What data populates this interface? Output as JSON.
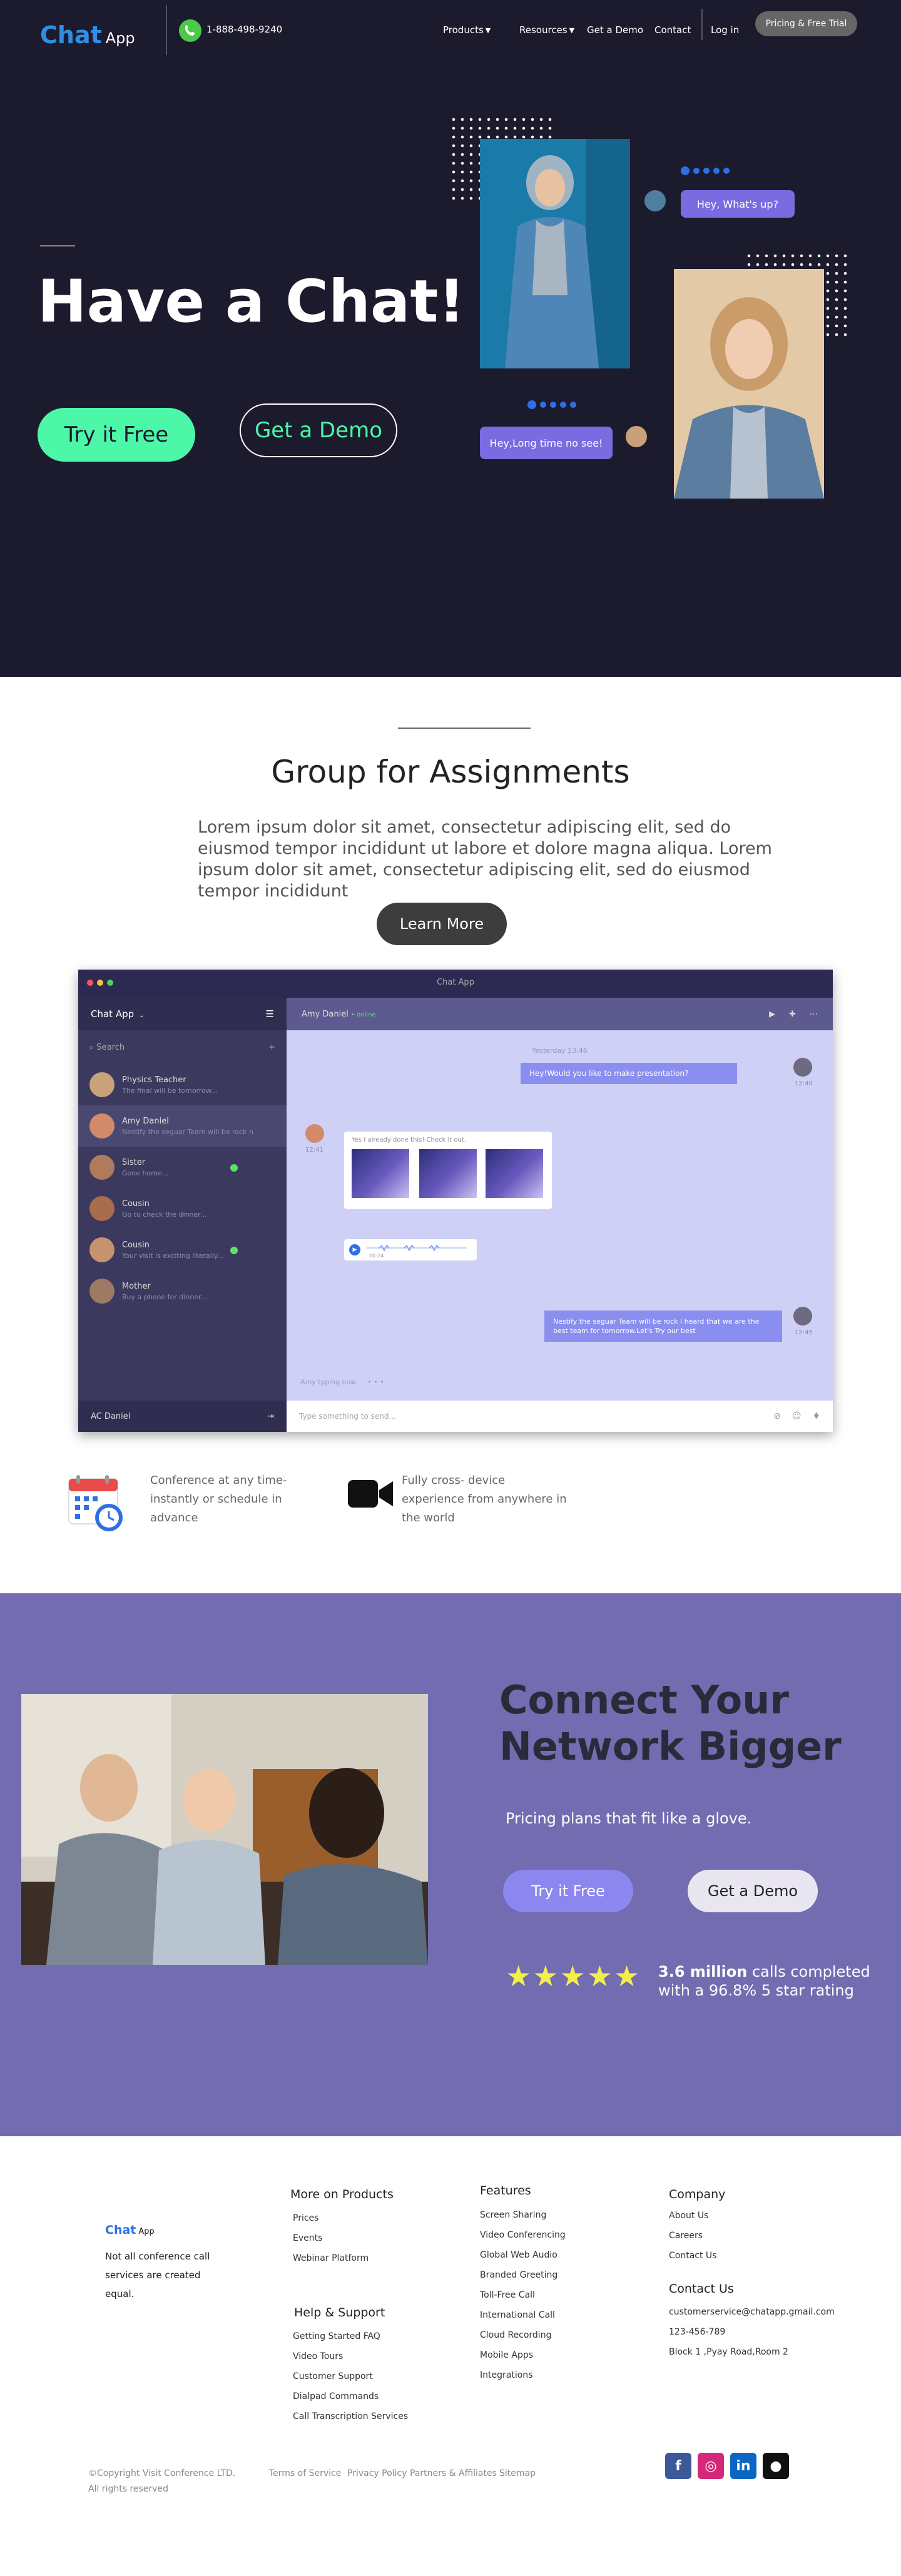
{
  "header": {
    "logo_main": "Chat",
    "logo_sub": "App",
    "phone": "1-888-498-9240",
    "nav": {
      "products": "Products",
      "resources": "Resources",
      "demo": "Get a Demo",
      "contact": "Contact",
      "login": "Log in",
      "trial": "Pricing & Free Trial"
    }
  },
  "hero": {
    "title": "Have a Chat!",
    "try_free": "Try it Free",
    "get_demo": "Get a Demo",
    "bubble_1": "Hey, What's up?",
    "bubble_2": "Hey,Long time no see!"
  },
  "assignments": {
    "title": "Group for Assignments",
    "body": "Lorem ipsum dolor sit amet, consectetur adipiscing elit, sed do eiusmod tempor incididunt ut labore et dolore magna aliqua. Lorem ipsum dolor sit amet, consectetur adipiscing elit, sed do eiusmod tempor incididunt",
    "learn_more": "Learn More"
  },
  "app_mock": {
    "window_title": "Chat App",
    "sidebar_title": "Chat App",
    "search_placeholder": "Search",
    "contacts": [
      {
        "name": "Physics Teacher",
        "preview": "The final will be tomorrow...",
        "online": false,
        "color": "#c9a27a"
      },
      {
        "name": "Amy Daniel",
        "preview": "Nestify the seguar Team will be rock n...",
        "online": false,
        "color": "#d28b6a"
      },
      {
        "name": "Sister",
        "preview": "Gone home...",
        "online": true,
        "color": "#b07a5c"
      },
      {
        "name": "Cousin",
        "preview": "Go to check the dinner...",
        "online": false,
        "color": "#a86c4e"
      },
      {
        "name": "Cousin",
        "preview": "Your visit is exciting literally...",
        "online": true,
        "color": "#c79270"
      },
      {
        "name": "Mother",
        "preview": "Buy a phone for dinner...",
        "online": false,
        "color": "#9e7a66"
      }
    ],
    "current_user": "AC Daniel",
    "chat_with": "Amy Daniel",
    "chat_status": "• online",
    "day_label": "Yesterday 13:46",
    "msg_1": "Hey!Would you like to make presentation?",
    "msg_1_time": "12:40",
    "msg_2": "Yes I already done this! Check it out.",
    "msg_2_time": "12:41",
    "audio_time": "00:24",
    "msg_3": "Nestify the seguar Team will be rock I heard that we are the best team for tomorrow.Let's Try our best",
    "msg_3_time": "12:45",
    "typing": "Amy typing now",
    "input_placeholder": "Type something to send..."
  },
  "features": [
    {
      "icon": "calendar-clock-icon",
      "text": "Conference at any time-instantly or schedule in advance"
    },
    {
      "icon": "video-camera-icon",
      "text": "Fully cross- device experience from anywhere in the world"
    }
  ],
  "connect": {
    "title_1": "Connect Your",
    "title_2": "Network Bigger",
    "subtitle": "Pricing plans that fit like a glove.",
    "try_free": "Try it Free",
    "get_demo": "Get a Demo",
    "stars": "★★★★★",
    "rating_bold": "3.6 million",
    "rating_text": " calls completed with a 96.8% 5 star rating"
  },
  "footer": {
    "logo_main": "Chat",
    "logo_sub": "App",
    "tagline": "Not all conference call services are created equal.",
    "more_on_products": "More on Products",
    "products_links": [
      "Prices",
      "Events",
      "Webinar Platform"
    ],
    "help_support": "Help & Support",
    "help_links": [
      "Getting Started FAQ",
      "Video Tours",
      "Customer Support",
      "Dialpad Commands",
      "Call Transcription Services"
    ],
    "features_title": "Features",
    "features_links": [
      "Screen Sharing",
      "Video Conferencing",
      "Global Web Audio",
      "Branded Greeting",
      "Toll-Free Call",
      "International Call",
      "Cloud Recording",
      "Mobile Apps",
      "Integrations"
    ],
    "company_title": "Company",
    "company_links": [
      "About Us",
      "Careers",
      "Contact Us"
    ],
    "contact_title": "Contact Us",
    "contact_links": [
      "customerservice@chatapp.gmail.com",
      "123-456-789",
      "Block 1 ,Pyay Road,Room 2"
    ],
    "copyright_1": "©Copyright Visit Conference LTD.",
    "copyright_2": "All rights reserved",
    "bottom_links": [
      "Terms of Service",
      "Privacy Policy",
      "Partners & Affiliates",
      "Sitemap"
    ],
    "social": [
      {
        "name": "facebook-icon",
        "glyph": "f",
        "color": "#3b5998"
      },
      {
        "name": "instagram-icon",
        "glyph": "◎",
        "color": "#d6287a"
      },
      {
        "name": "linkedin-icon",
        "glyph": "in",
        "color": "#0a66c2"
      },
      {
        "name": "github-icon",
        "glyph": "●",
        "color": "#111111"
      }
    ]
  }
}
